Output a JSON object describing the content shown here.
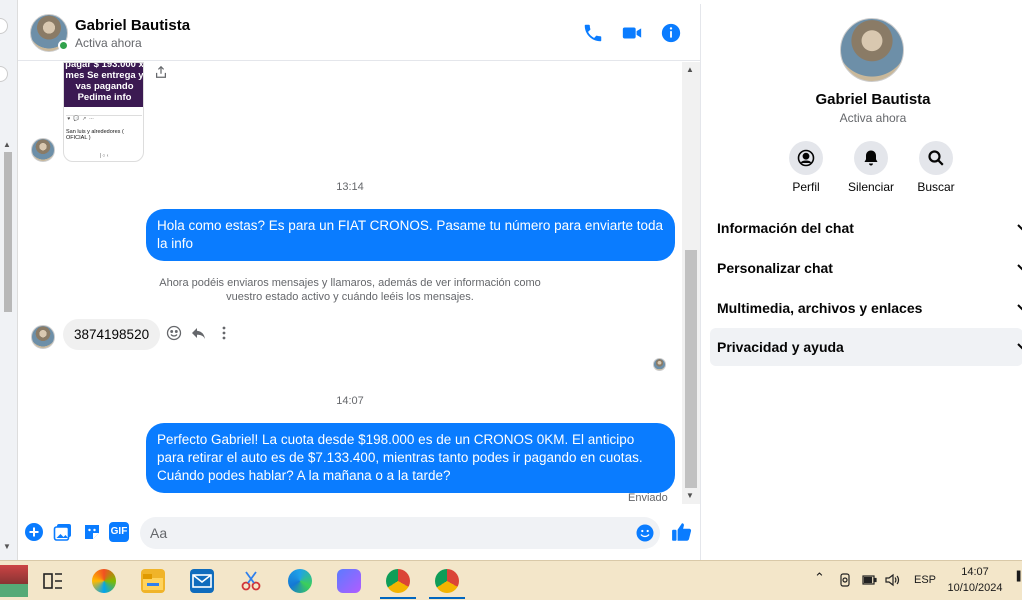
{
  "contact": {
    "name": "Gabriel Bautista",
    "status": "Activa ahora"
  },
  "image_card": {
    "text": "pagar $ 193.000 x mes Se entrega y vas pagando Pedime info",
    "page_name": "San luis y alrededores ( OFICIAL )"
  },
  "messages": {
    "time1": "13:14",
    "out1": "Hola como estas?  Es para un FIAT CRONOS. Pasame tu número para enviarte toda la info",
    "system_note": "Ahora podéis enviaros mensajes y llamaros, además de ver información como vuestro estado activo y cuándo leéis los mensajes.",
    "in1": "3874198520",
    "time2": "14:07",
    "out2": "Perfecto Gabriel!  La cuota desde $198.000 es de un CRONOS 0KM. El anticipo para retirar el auto es de $7.133.400, mientras tanto podes ir pagando en cuotas. Cuándo podes hablar? A la mañana o a la tarde?",
    "sent_label": "Enviado"
  },
  "composer": {
    "placeholder": "Aa",
    "gif_label": "GIF"
  },
  "right_panel": {
    "actions": [
      {
        "label": "Perfil",
        "icon": "profile-icon"
      },
      {
        "label": "Silenciar",
        "icon": "bell-icon"
      },
      {
        "label": "Buscar",
        "icon": "search-icon"
      }
    ],
    "sections": [
      {
        "label": "Información del chat"
      },
      {
        "label": "Personalizar chat"
      },
      {
        "label": "Multimedia, archivos y enlaces"
      },
      {
        "label": "Privacidad y ayuda"
      }
    ]
  },
  "taskbar": {
    "language": "ESP",
    "time": "14:07",
    "date": "10/10/2024"
  },
  "colors": {
    "accent": "#0a7cff",
    "bubble_in": "#f0f0f0",
    "online": "#31a24c",
    "taskbar": "#f3e6c9"
  }
}
